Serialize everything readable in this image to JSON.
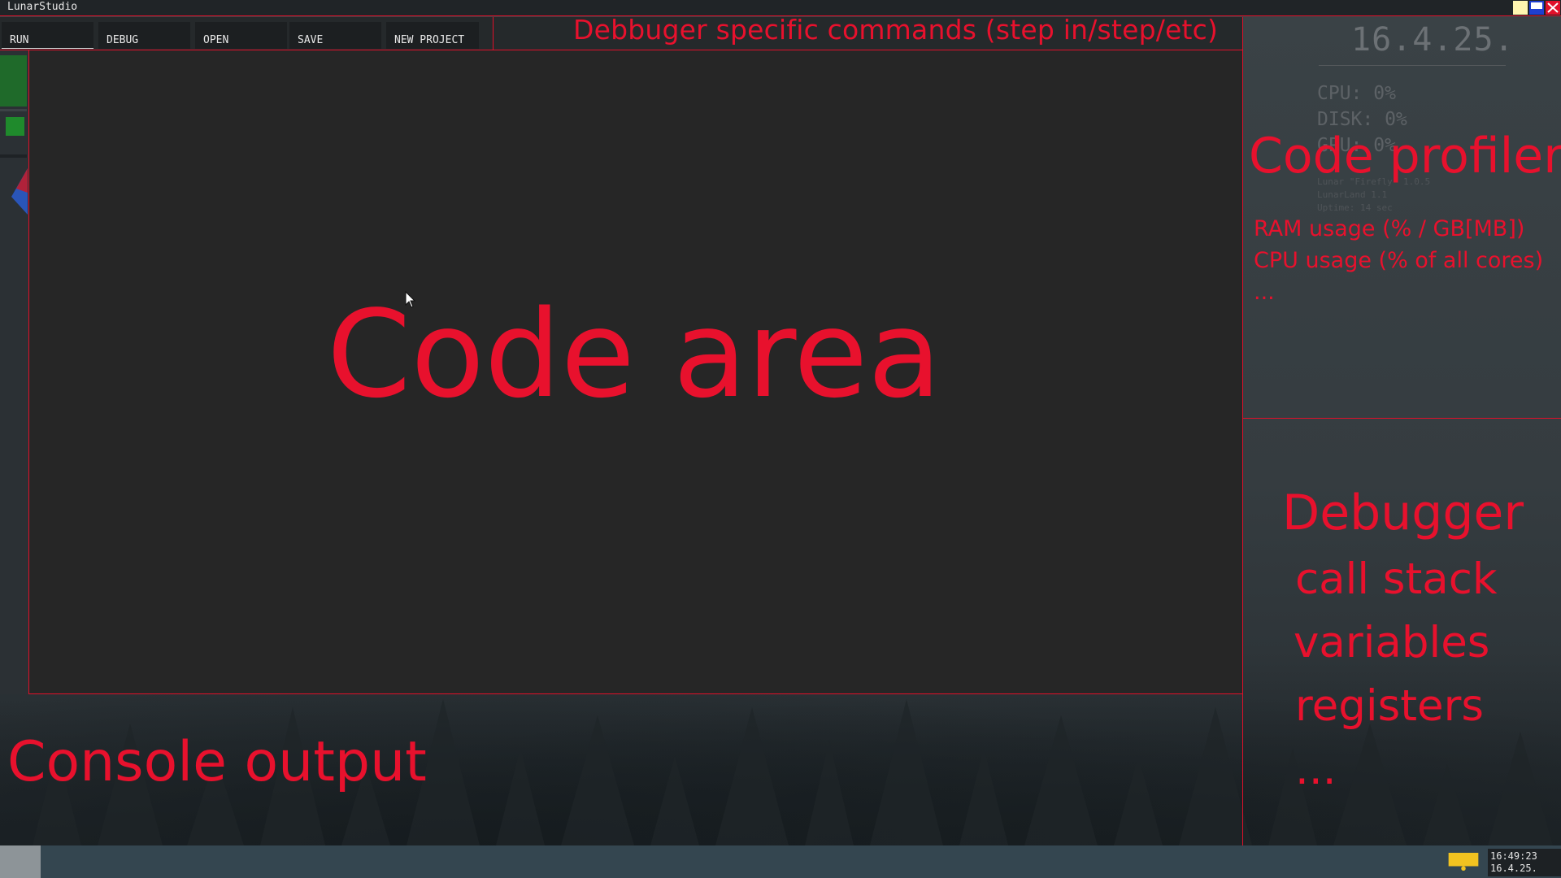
{
  "window": {
    "title": "LunarStudio"
  },
  "toolbar": {
    "buttons": [
      {
        "label": "RUN"
      },
      {
        "label": "DEBUG"
      },
      {
        "label": "OPEN"
      },
      {
        "label": "SAVE"
      },
      {
        "label": "NEW PROJECT"
      }
    ],
    "debugger_commands_note": "Debbuger specific commands (step in/step/etc)"
  },
  "code_area": {
    "note": "Code area"
  },
  "console": {
    "note": "Console output"
  },
  "profiler": {
    "date": "16.4.25.",
    "stats": {
      "cpu": "CPU: 0%",
      "disk": "DISK: 0%",
      "gpu": "GPU: 0%"
    },
    "info": {
      "version": "Lunar \"Firefly\" 1.0.5",
      "land": "LunarLand 1.1",
      "uptime": "Uptime: 14 sec"
    },
    "title": "Code profiler",
    "lines": [
      "RAM usage (% / GB[MB])",
      "CPU usage (% of all cores)",
      "..."
    ]
  },
  "debugger": {
    "title": "Debugger",
    "lines": [
      "call stack",
      "variables",
      "registers",
      "..."
    ]
  },
  "taskbar": {
    "clock_time": "16:49:23",
    "clock_date": "16.4.25."
  },
  "colors": {
    "annotation": "#e8112d",
    "code_area_bg": "#262626",
    "toolbar_bg": "#25292b",
    "taskbar_bg": "#344650"
  }
}
